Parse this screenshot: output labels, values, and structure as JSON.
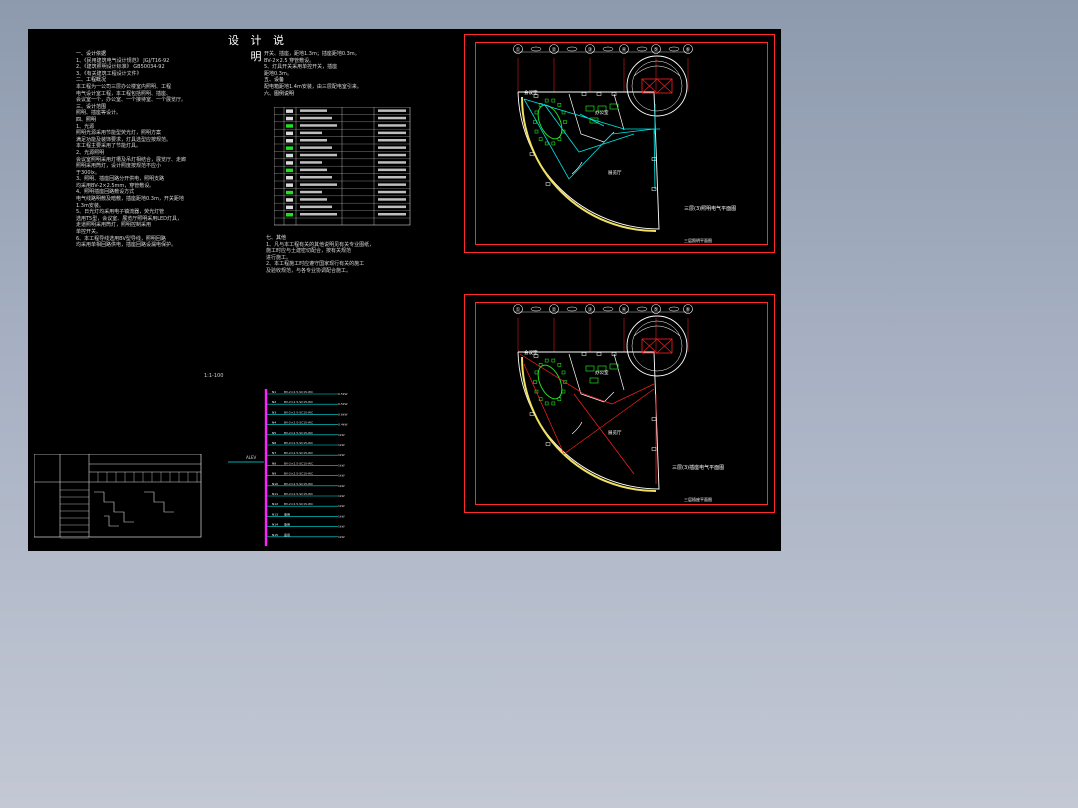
{
  "sheet_title": "设 计 说 明",
  "notes_left": [
    {
      "text": "一、设计依据",
      "h": true
    },
    {
      "text": "1、《民用建筑电气设计规范》  JGJ/T16-92"
    },
    {
      "text": "2、《建筑照明设计标准》  GB50034-92"
    },
    {
      "text": "3、《有关建筑工程设计文件》"
    },
    {
      "text": "二、工程概况",
      "h": true
    },
    {
      "text": "本工程为一公司三层办公楼室内照明、工程"
    },
    {
      "text": "电气设计室工程，本工程包括照明、插座、"
    },
    {
      "text": "会议室一个，办公室、一个接待室、一个展览厅。"
    },
    {
      "text": "三、设计范围",
      "h": true
    },
    {
      "text": "照明、插座等设计。"
    },
    {
      "text": "四、照明",
      "h": true
    },
    {
      "text": "1、光源"
    },
    {
      "text": "照明光源采用节能型荧光灯，照明方案"
    },
    {
      "text": "满足功能及装饰要求，灯具选型应按规范。"
    },
    {
      "text": "本工程主要采用了节能灯具。"
    },
    {
      "text": "2、光源照明"
    },
    {
      "text": "会议室照明采用灯槽及吊灯相结合，展览厅、走廊"
    },
    {
      "text": "照明采用筒灯，设计照度按规范不应小"
    },
    {
      "text": "于300lx。"
    },
    {
      "text": "3、照明、插座回路分开供电，照明支路"
    },
    {
      "text": "均采用BV-2×2.5mm，穿管敷设。"
    },
    {
      "text": "4、照明插座回路敷设方式"
    },
    {
      "text": "电气线路明敷及暗敷，插座距地0.3m，开关距地"
    },
    {
      "text": "1.3m安装。"
    },
    {
      "text": "5、日光灯均采用电子镇流器，荧光灯管"
    },
    {
      "text": "选用T5型，会议室、展览厅照明采用LED灯具，"
    },
    {
      "text": "走道照明采用筒灯，照明控制采用"
    },
    {
      "text": "单控开关。"
    },
    {
      "text": "6、本工程导线选用BV型导线，照明回路"
    },
    {
      "text": "均采用单相回路供电，插座回路设漏电保护。"
    }
  ],
  "notes_right_top": [
    {
      "text": "开关、插座，距地1.3m；插座距地0.3m。"
    },
    {
      "text": "BV-2×2.5 穿管敷设。"
    },
    {
      "text": "5、灯具开关采用单控开关，插座"
    },
    {
      "text": "距地0.3m。"
    },
    {
      "text": "五、设备",
      "h": true
    },
    {
      "text": "配电箱距地1.4m安装，由三层配电室引来。"
    },
    {
      "text": "六、图例说明",
      "h": true
    }
  ],
  "notes_right_bottom": [
    {
      "text": "七、其他",
      "h": true
    },
    {
      "text": "1、凡与本工程有关的其他说明见有关专业图纸，"
    },
    {
      "text": "施工时应与土建密切配合，按有关规范"
    },
    {
      "text": "进行施工。"
    },
    {
      "text": "2、本工程施工时应遵守国家现行有关的施工"
    },
    {
      "text": "及验收规范，与各专业协调配合施工。"
    }
  ],
  "scale_note": "1:1-100",
  "panel_label": "ALEV",
  "circuits": [
    {
      "id": "N1",
      "desc": "BV-2×2.5-SC15-WC",
      "load": "0.5kW"
    },
    {
      "id": "N2",
      "desc": "BV-2×2.5-SC15-WC",
      "load": "0.5kW"
    },
    {
      "id": "N3",
      "desc": "BV-2×2.5-SC15-WC",
      "load": "0.6kW"
    },
    {
      "id": "N4",
      "desc": "BV-2×2.5-SC15-WC",
      "load": "0.4kW"
    },
    {
      "id": "N5",
      "desc": "BV-2×2.5-SC15-WC",
      "load": "1kW"
    },
    {
      "id": "N6",
      "desc": "BV-2×2.5-SC15-WC",
      "load": "1kW"
    },
    {
      "id": "N7",
      "desc": "BV-2×2.5-SC15-WC",
      "load": "1kW"
    },
    {
      "id": "N8",
      "desc": "BV-2×2.5-SC15-WC",
      "load": "1kW"
    },
    {
      "id": "N9",
      "desc": "BV-2×2.5-SC15-WC",
      "load": "1kW"
    },
    {
      "id": "N10",
      "desc": "BV-2×2.5-SC15-WC",
      "load": "1kW"
    },
    {
      "id": "N11",
      "desc": "BV-2×2.5-SC15-WC",
      "load": "1kW"
    },
    {
      "id": "N12",
      "desc": "BV-2×2.5-SC15-WC",
      "load": "1kW"
    },
    {
      "id": "N13",
      "desc": "备用",
      "load": "1kW"
    },
    {
      "id": "N14",
      "desc": "备用",
      "load": "1kW"
    },
    {
      "id": "N15",
      "desc": "备用",
      "load": "1kW"
    }
  ],
  "plan_top": {
    "axis_labels": [
      "①",
      "②",
      "③",
      "④",
      "⑤",
      "⑥",
      "⑦"
    ],
    "room_labels": [
      "会议室",
      "展览厅",
      "办公室"
    ],
    "caption": "三层(3)照明电气平面图",
    "caption_small": "三层照明平面图"
  },
  "plan_bottom": {
    "axis_labels": [
      "①",
      "②",
      "③",
      "④",
      "⑤",
      "⑥",
      "⑦"
    ],
    "room_labels": [
      "会议室",
      "展览厅",
      "办公室"
    ],
    "caption": "三层(3)插座电气平面图",
    "caption_small": "三层插座平面图"
  },
  "colors": {
    "background_top": "#8d9aad",
    "background_bottom": "#c3c8d4",
    "sheet": "#000000",
    "frame": "#ff2b2b",
    "wiring_cyan": "#00e5e5",
    "wiring_red": "#ff2020",
    "furniture_green": "#20e020",
    "bus_magenta": "#ff20ff",
    "wall_yellow": "#f0e060"
  }
}
